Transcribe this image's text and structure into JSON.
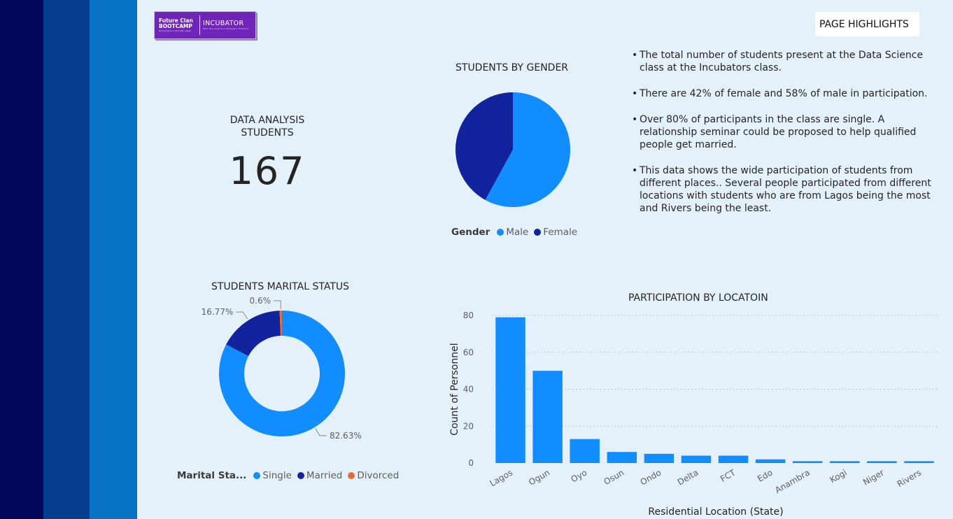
{
  "logo": {
    "line1": "Future Clan",
    "line2": "BOOTCAMP",
    "tagline": "Nurturing for a tech life, aging",
    "brand": "INCUBATOR",
    "brand_sub": "Well-Rounded and Strategic Solution"
  },
  "highlights_button": "PAGE HIGHLIGHTS",
  "kpi": {
    "label_line1": "DATA ANALYSIS",
    "label_line2": "STUDENTS",
    "value": "167"
  },
  "highlights": [
    "The total number of students present at the Data Science class at the Incubators class.",
    "There are 42% of female and 58% of  male in participation.",
    "Over 80% of participants in the class are single. A relationship seminar could be proposed to help qualified people get married.",
    "This data shows the wide participation of students from different places.. Several people participated from different locations with students who are from Lagos being the most and Rivers being the least."
  ],
  "colors": {
    "male": "#118DFF",
    "female": "#12239E",
    "single": "#118DFF",
    "married": "#12239E",
    "divorced": "#E66C37",
    "bar": "#118DFF"
  },
  "chart_data": [
    {
      "type": "pie",
      "title": "STUDENTS BY GENDER",
      "legend_title": "Gender",
      "categories": [
        "Male",
        "Female"
      ],
      "values": [
        58,
        42
      ],
      "legend": "bottom"
    },
    {
      "type": "pie",
      "variant": "donut",
      "title": "STUDENTS MARITAL STATUS",
      "legend_title": "Marital Sta...",
      "categories": [
        "Single",
        "Married",
        "Divorced"
      ],
      "values": [
        82.63,
        16.77,
        0.6
      ],
      "data_labels": [
        "82.63%",
        "16.77%",
        "0.6%"
      ],
      "legend": "bottom"
    },
    {
      "type": "bar",
      "title": "PARTICIPATION BY LOCATOIN",
      "xlabel": "Residential Location (State)",
      "ylabel": "Count of Personnel",
      "categories": [
        "Lagos",
        "Ogun",
        "Oyo",
        "Osun",
        "Ondo",
        "Delta",
        "FCT",
        "Edo",
        "Anambra",
        "Kogi",
        "Niger",
        "Rivers"
      ],
      "values": [
        79,
        50,
        13,
        6,
        5,
        4,
        4,
        2,
        1,
        1,
        1,
        1
      ],
      "yticks": [
        "0",
        "20",
        "40",
        "60",
        "80"
      ],
      "ylim": [
        0,
        80
      ],
      "grid": true
    }
  ]
}
